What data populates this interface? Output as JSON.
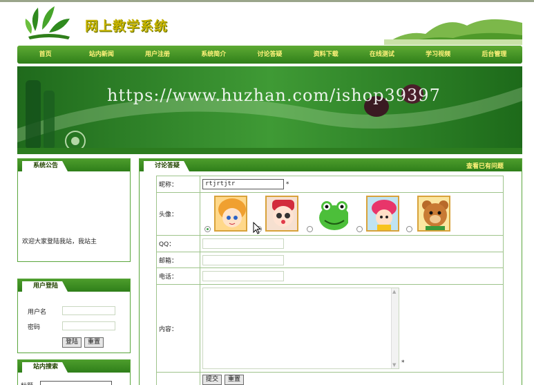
{
  "site": {
    "title": "网上教学系统",
    "watermark": "https://www.huzhan.com/ishop39397"
  },
  "nav": [
    "首页",
    "站内新闻",
    "用户注册",
    "系统简介",
    "讨论答疑",
    "资料下载",
    "在线测试",
    "学习视频",
    "后台管理"
  ],
  "notice": {
    "title": "系统公告",
    "text": "欢迎大家登陆我站，我站主"
  },
  "login": {
    "title": "用户登陆",
    "username_label": "用户名",
    "password_label": "密码",
    "login_button": "登陆",
    "reset_button": "重置"
  },
  "search": {
    "title": "站内搜索",
    "label": "标题"
  },
  "main": {
    "title": "讨论答疑",
    "view_link": "查看已有问题",
    "nickname_label": "昵称：",
    "nickname_value": "rtjrtjtr",
    "avatar_label": "头像：",
    "qq_label": "QQ：",
    "email_label": "邮箱：",
    "phone_label": "电话：",
    "content_label": "内容：",
    "required_mark": "*",
    "submit_button": "提交",
    "reset_button": "重置",
    "avatars": [
      {
        "icon": "avatar-girl-icon",
        "selected": true
      },
      {
        "icon": "avatar-baby-icon",
        "selected": false
      },
      {
        "icon": "avatar-frog-icon",
        "selected": false
      },
      {
        "icon": "avatar-pink-girl-icon",
        "selected": false
      },
      {
        "icon": "avatar-bear-icon",
        "selected": false
      }
    ]
  },
  "colors": {
    "brand_green": "#2f7f1a",
    "nav_text": "#fff27a",
    "border": "#58a53a"
  }
}
